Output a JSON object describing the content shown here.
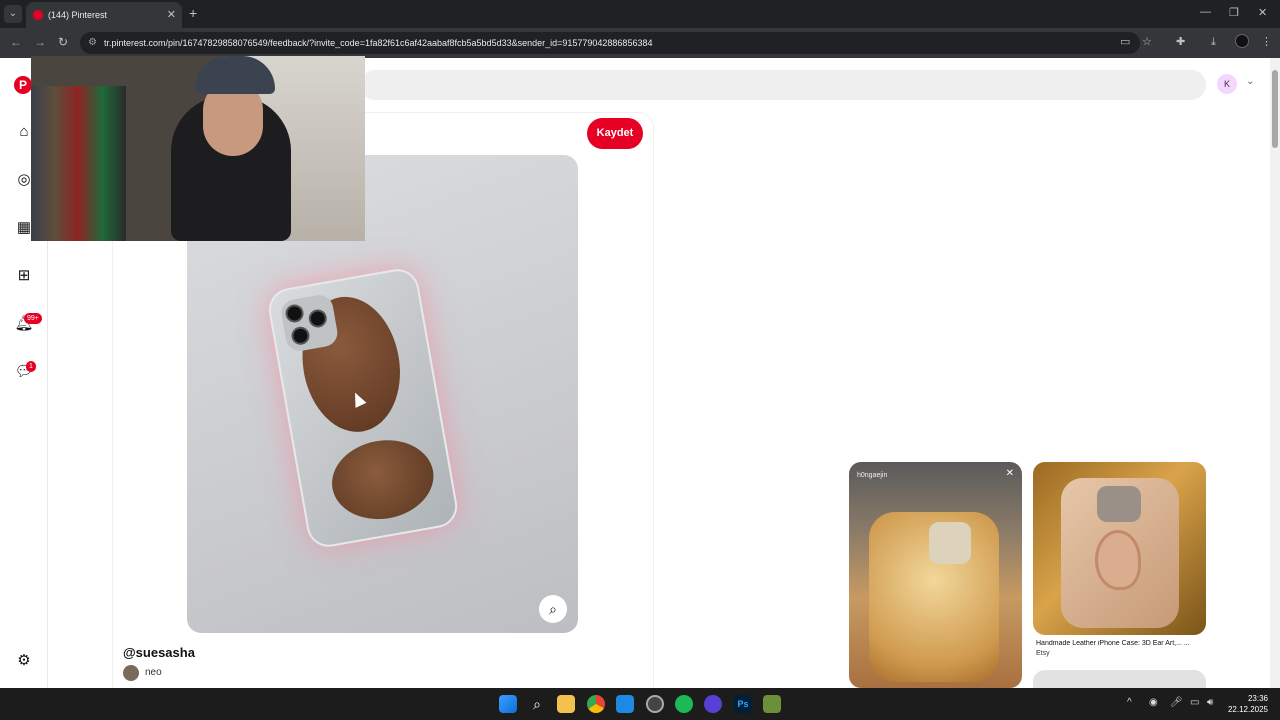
{
  "browser": {
    "tab_title": "(144) Pinterest",
    "url": "tr.pinterest.com/pin/16747829858076549/feedback/?invite_code=1fa82f61c6af42aabaf8fcb5a5bd5d33&sender_id=915779042886856384"
  },
  "sidebar": {
    "notifications_badge": "99+",
    "messages_badge": "1"
  },
  "header": {
    "avatar_initial": "K"
  },
  "pin": {
    "save_label": "Kaydet",
    "username": "@suesasha",
    "user_name": "neo"
  },
  "related": {
    "pin1_caption_user": "h0ngaejin",
    "pin2_title": "Handmade Leather iPhone Case: 3D Ear Art,... ...",
    "pin2_source": "Etsy"
  },
  "taskbar": {
    "time": "23:36",
    "date": "22.12.2025"
  },
  "colors": {
    "brand": "#e60023"
  }
}
